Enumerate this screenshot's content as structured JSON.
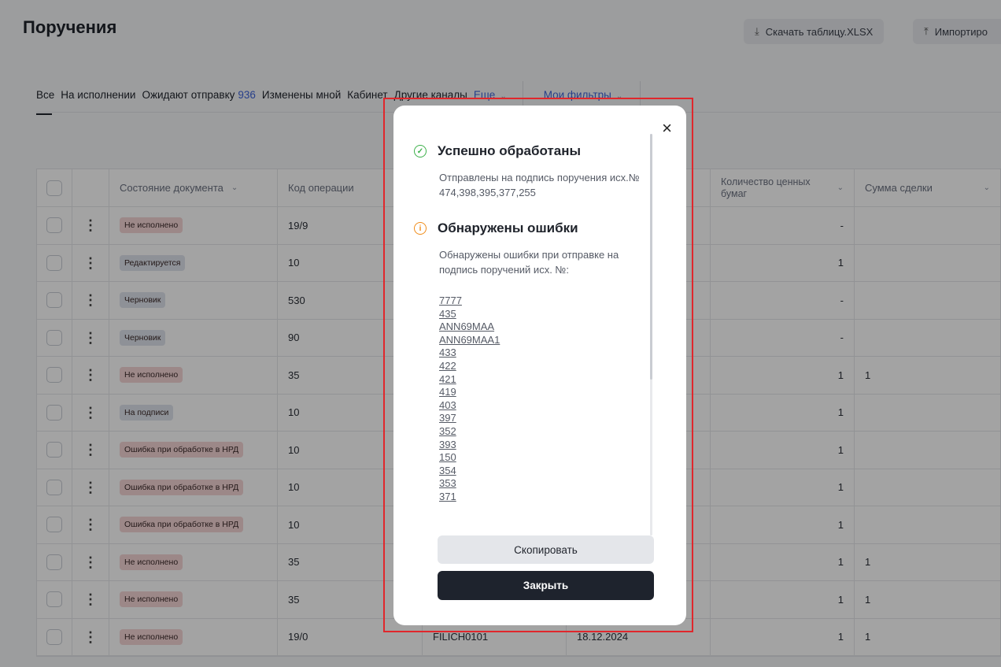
{
  "page": {
    "title": "Поручения",
    "download_label": "Скачать таблицу.XLSX",
    "import_label": "Импортиро"
  },
  "tabs": [
    {
      "label": "Все"
    },
    {
      "label": "На исполнении"
    },
    {
      "label": "Ожидают отправку",
      "count": "936"
    },
    {
      "label": "Изменены мной"
    },
    {
      "label": "Кабинет"
    },
    {
      "label": "Другие каналы"
    },
    {
      "label": "Еще"
    },
    {
      "label": "Мои фильтры"
    }
  ],
  "table": {
    "headers": {
      "state": "Состояние документа",
      "op_code": "Код операции",
      "quantity": "Количество ценных бумаг",
      "amount": "Сумма сделки"
    },
    "rows": [
      {
        "state": "Не исполнено",
        "code": "19/9",
        "col5": "",
        "col6": "",
        "qty": "-",
        "amount": ""
      },
      {
        "state": "Редактируется",
        "code": "10",
        "col5": "",
        "col6": "",
        "qty": "1",
        "amount": ""
      },
      {
        "state": "Черновик",
        "code": "530",
        "col5": "",
        "col6": "",
        "qty": "-",
        "amount": ""
      },
      {
        "state": "Черновик",
        "code": "90",
        "col5": "",
        "col6": "",
        "qty": "-",
        "amount": ""
      },
      {
        "state": "Не исполнено",
        "code": "35",
        "col5": "",
        "col6": "",
        "qty": "1",
        "amount": "1"
      },
      {
        "state": "На подписи",
        "code": "10",
        "col5": "",
        "col6": "",
        "qty": "1",
        "amount": ""
      },
      {
        "state": "Ошибка при обработке в НРД",
        "code": "10",
        "col5": "",
        "col6": "",
        "qty": "1",
        "amount": ""
      },
      {
        "state": "Ошибка при обработке в НРД",
        "code": "10",
        "col5": "",
        "col6": "",
        "qty": "1",
        "amount": ""
      },
      {
        "state": "Ошибка при обработке в НРД",
        "code": "10",
        "col5": "",
        "col6": "",
        "qty": "1",
        "amount": ""
      },
      {
        "state": "Не исполнено",
        "code": "35",
        "col5": "",
        "col6": "",
        "qty": "1",
        "amount": "1"
      },
      {
        "state": "Не исполнено",
        "code": "35",
        "col5": "",
        "col6": "",
        "qty": "1",
        "amount": "1"
      },
      {
        "state": "Не исполнено",
        "code": "19/0",
        "col5": "FILICH0101",
        "col6": "18.12.2024",
        "qty": "1",
        "amount": "1"
      }
    ]
  },
  "modal": {
    "success_title": "Успешно обработаны",
    "success_text": "Отправлены на подпись поручения исх.№ 474,398,395,377,255",
    "error_title": "Обнаружены ошибки",
    "error_text": "Обнаружены ошибки при отправке на подпись поручений исх. №:",
    "error_numbers": [
      "7777",
      "435",
      "ANN69MAA",
      "ANN69MAA1",
      "433",
      "422",
      "421",
      "419",
      "403",
      "397",
      "352",
      "393",
      "150",
      "354",
      "353",
      "371"
    ],
    "copy_label": "Скопировать",
    "close_label": "Закрыть",
    "close_icon": "×"
  }
}
